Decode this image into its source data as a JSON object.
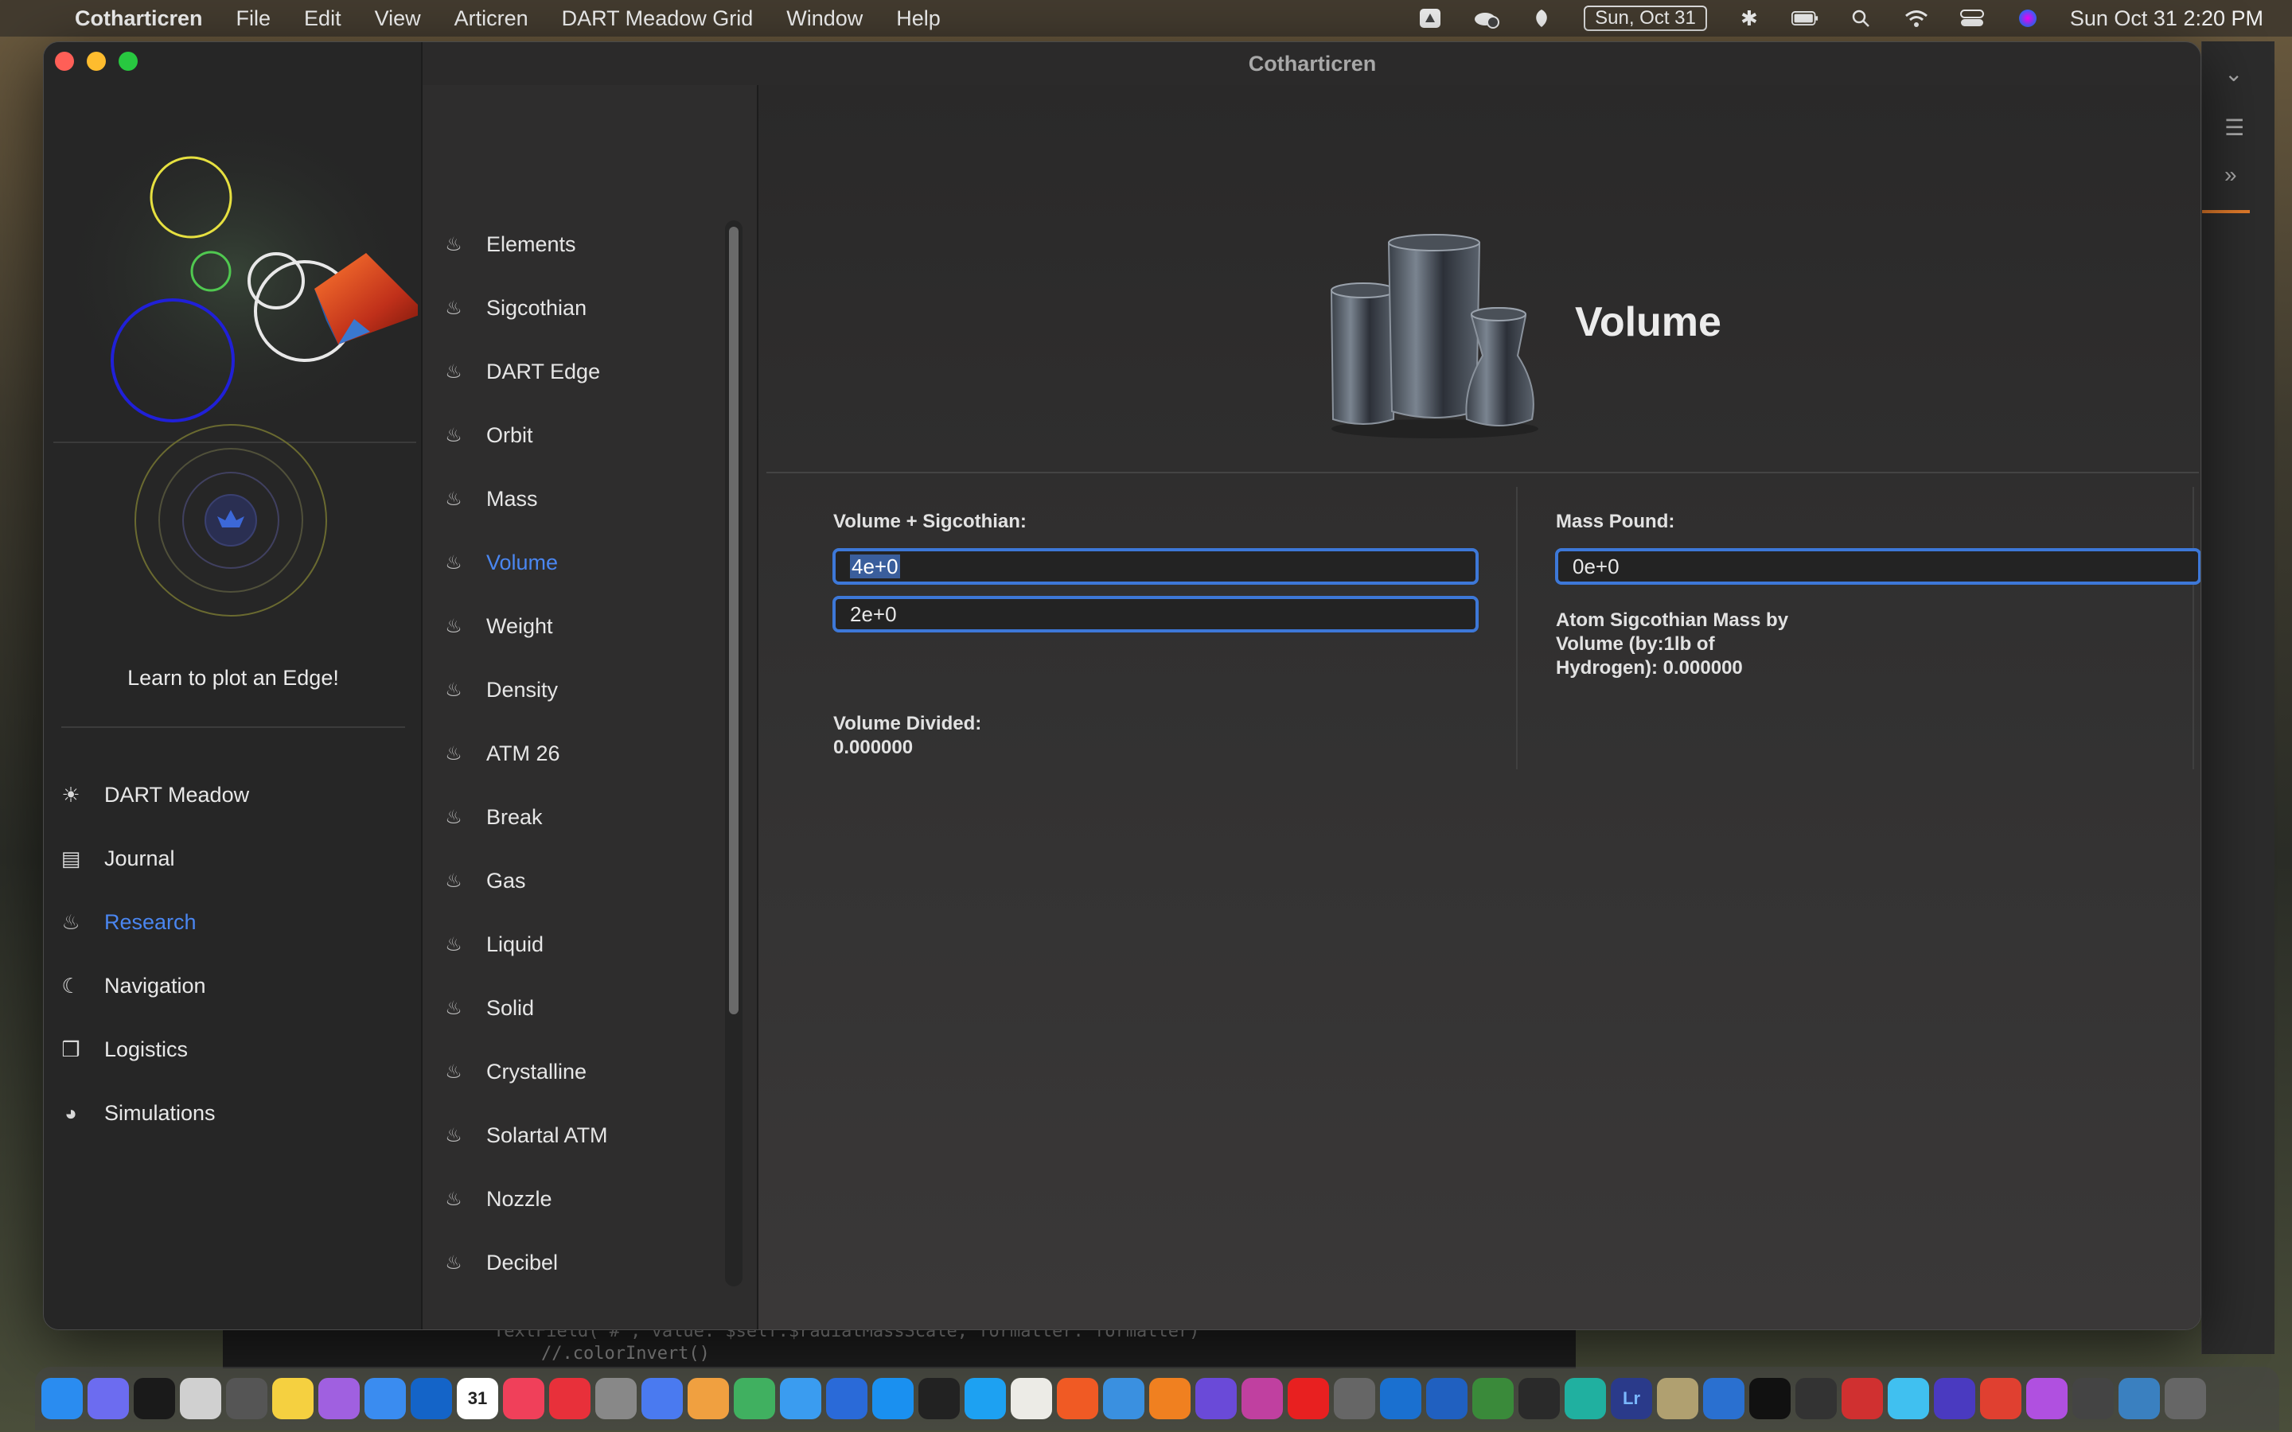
{
  "menubar": {
    "app_name": "Cotharticren",
    "menus": [
      "File",
      "Edit",
      "View",
      "Articren",
      "DART Meadow Grid",
      "Window",
      "Help"
    ],
    "date_badge": "Sun, Oct 31",
    "clock": "Sun Oct 31  2:20 PM"
  },
  "window": {
    "title": "Cotharticren"
  },
  "sidebar": {
    "tagline": "Learn to plot an Edge!",
    "items": [
      {
        "label": "DART Meadow",
        "icon": "sun-icon",
        "glyph": "☀"
      },
      {
        "label": "Journal",
        "icon": "journal-icon",
        "glyph": "▤"
      },
      {
        "label": "Research",
        "icon": "flame-icon",
        "glyph": "♨",
        "active": true
      },
      {
        "label": "Navigation",
        "icon": "moon-icon",
        "glyph": "☾"
      },
      {
        "label": "Logistics",
        "icon": "cube-icon",
        "glyph": "❒"
      },
      {
        "label": "Simulations",
        "icon": "pie-chart-icon",
        "glyph": "◕"
      }
    ]
  },
  "list": {
    "items": [
      "Elements",
      "Sigcothian",
      "DART Edge",
      "Orbit",
      "Mass",
      "Volume",
      "Weight",
      "Density",
      "ATM 26",
      "Break",
      "Gas",
      "Liquid",
      "Solid",
      "Crystalline",
      "Solartal ATM",
      "Nozzle",
      "Decibel"
    ],
    "selected": "Volume",
    "icon_glyph": "♨"
  },
  "detail": {
    "title": "Volume",
    "left": {
      "label": "Volume + Sigcothian:",
      "field1_value": "4e+0",
      "field2_value": "2e+0",
      "result_label": "Volume Divided:",
      "result_value": "0.000000"
    },
    "right": {
      "label": "Mass Pound:",
      "field_value": "0e+0",
      "result_line1": "Atom Sigcothian Mass by",
      "result_line2": "Volume (by:1lb of",
      "result_line3": "Hydrogen): 0.000000"
    }
  },
  "background": {
    "code_line1": "TextField(\"#\", value: $self.$radiatMassScale, formatter: formatter)",
    "code_line2": "//.colorInvert()"
  },
  "colors": {
    "accent": "#4a86f0",
    "field_border": "#3d78d8"
  },
  "dock": {
    "icons": [
      "finder-icon",
      "launchpad-icon",
      "activity-monitor-icon",
      "preview-icon",
      "screenshot-icon",
      "notes-icon",
      "speech-icon",
      "mail-icon",
      "outlook-icon",
      "calendar-icon",
      "music-icon",
      "news-icon",
      "system-settings-icon",
      "messenger-icon",
      "photos-icon",
      "maps-icon",
      "safari-icon",
      "files-icon",
      "app-store-icon",
      "terminal-icon",
      "twitter-icon",
      "chrome-icon",
      "brave-icon",
      "xcode-icon",
      "blender-icon",
      "pixelmator-icon",
      "shortcuts-icon",
      "youtube-icon",
      "calculator-icon",
      "windows-icon",
      "bookmark-icon",
      "globe-icon",
      "vectornator-icon",
      "toolbox-icon",
      "lightroom-icon",
      "utility-icon",
      "muse-icon",
      "code-icon",
      "help-icon",
      "affinity-icon",
      "nova-icon",
      "crystal-icon",
      "paint-icon",
      "podcasts-icon",
      "audio-icon",
      "network-icon",
      "trash-icon"
    ],
    "calendar_day": "31",
    "lightroom_label": "Lr"
  }
}
